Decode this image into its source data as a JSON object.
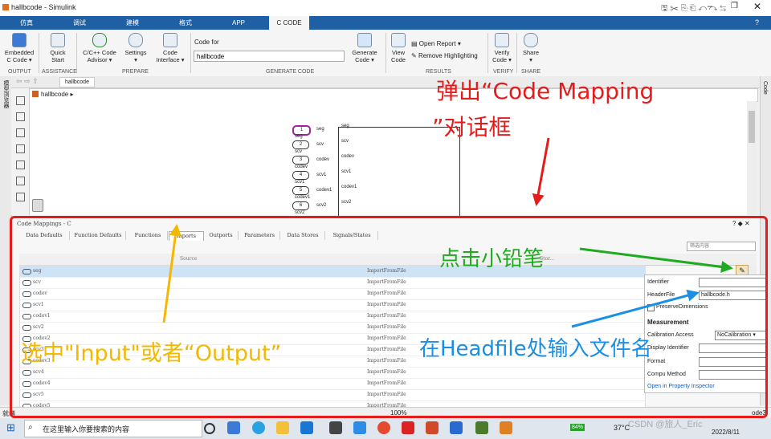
{
  "window": {
    "title": "hallbcode - Simulink"
  },
  "tabs": [
    "仿真",
    "调试",
    "建模",
    "格式",
    "APP",
    "C CODE"
  ],
  "ribbon": {
    "buttons": [
      {
        "label1": "Embedded",
        "label2": "C Code ▾"
      },
      {
        "label1": "Quick",
        "label2": "Start"
      },
      {
        "label1": "C/C++ Code",
        "label2": "Advisor ▾"
      },
      {
        "label1": "Settings",
        "label2": "▾"
      },
      {
        "label1": "Code",
        "label2": "Interface ▾"
      },
      {
        "label1": "Generate",
        "label2": "Code ▾"
      },
      {
        "label1": "View",
        "label2": "Code"
      },
      {
        "label1": "Verify",
        "label2": "Code ▾"
      },
      {
        "label1": "Share",
        "label2": "▾"
      }
    ],
    "code_for_label": "Code for",
    "code_for_value": "hallbcode",
    "open_report": "Open Report",
    "remove_highlighting": "Remove Highlighting",
    "sections": [
      "OUTPUT",
      "ASSISTANCE",
      "PREPARE",
      "GENERATE CODE",
      "RESULTS",
      "VERIFY",
      "SHARE"
    ]
  },
  "nav": {
    "model_tab": "hallbcode",
    "breadcrumb": "hallbcode ▸"
  },
  "side": {
    "left": "模型浏览器",
    "right": "Code"
  },
  "model_ports": [
    {
      "num": "1",
      "name": "seg",
      "out": "seg"
    },
    {
      "num": "2",
      "name": "scv",
      "out": "scv"
    },
    {
      "num": "3",
      "name": "codev",
      "out": "codev"
    },
    {
      "num": "4",
      "name": "scv1",
      "out": "scv1"
    },
    {
      "num": "5",
      "name": "codev1",
      "out": "codev1"
    },
    {
      "num": "6",
      "name": "scv2",
      "out": "scv2"
    }
  ],
  "code_mappings": {
    "title": "Code Mappings - C",
    "tabs": [
      "Data Defaults",
      "Function Defaults",
      "Functions",
      "Inports",
      "Outports",
      "Parameters",
      "Data Stores",
      "Signals/States"
    ],
    "filter_placeholder": "筛选内容",
    "column_source": "Source",
    "column_storage": "Stor...",
    "rows": [
      {
        "source": "seg",
        "storage": "ImportFromFile"
      },
      {
        "source": "scv",
        "storage": "ImportFromFile"
      },
      {
        "source": "codev",
        "storage": "ImportFromFile"
      },
      {
        "source": "scv1",
        "storage": "ImportFromFile"
      },
      {
        "source": "codev1",
        "storage": "ImportFromFile"
      },
      {
        "source": "scv2",
        "storage": "ImportFromFile"
      },
      {
        "source": "codev2",
        "storage": "ImportFromFile"
      },
      {
        "source": "scv3",
        "storage": "ImportFromFile"
      },
      {
        "source": "codev3",
        "storage": "ImportFromFile"
      },
      {
        "source": "scv4",
        "storage": "ImportFromFile"
      },
      {
        "source": "codev4",
        "storage": "ImportFromFile"
      },
      {
        "source": "scv5",
        "storage": "ImportFromFile"
      },
      {
        "source": "codev5",
        "storage": "ImportFromFile"
      }
    ]
  },
  "properties": {
    "identifier_label": "Identifier",
    "headerfile_label": "HeaderFile",
    "headerfile_value": "hallbcode.h",
    "preserve_label": "PreserveDimensions",
    "measurement_heading": "Measurement",
    "calibration_label": "Calibration Access",
    "calibration_value": "NoCalibration",
    "display_label": "Display Identifier",
    "format_label": "Format",
    "compu_label": "Compu Method",
    "open_inspector": "Open in Property Inspector"
  },
  "status": {
    "left": "就绪",
    "zoom": "100%",
    "solver": "ode3"
  },
  "taskbar": {
    "search_placeholder": "在这里输入你要搜索的内容",
    "battery": "84%",
    "weather": "37°C",
    "date": "2022/8/11",
    "watermark": "CSDN @旅人_Eric"
  },
  "annotations": {
    "red_line1": "弹出“Code  Mapping",
    "red_line2": "”对话框",
    "green": "点击小铅笔",
    "yellow": "选中\"Input\"或者“Output”",
    "blue": "在Headfile处输入文件名"
  },
  "colors": {
    "ribbon_tab": "#1f5fa3",
    "red": "#e41c1c",
    "green": "#1faa1f",
    "yellow": "#f5b800",
    "blue": "#1a8fe6"
  }
}
